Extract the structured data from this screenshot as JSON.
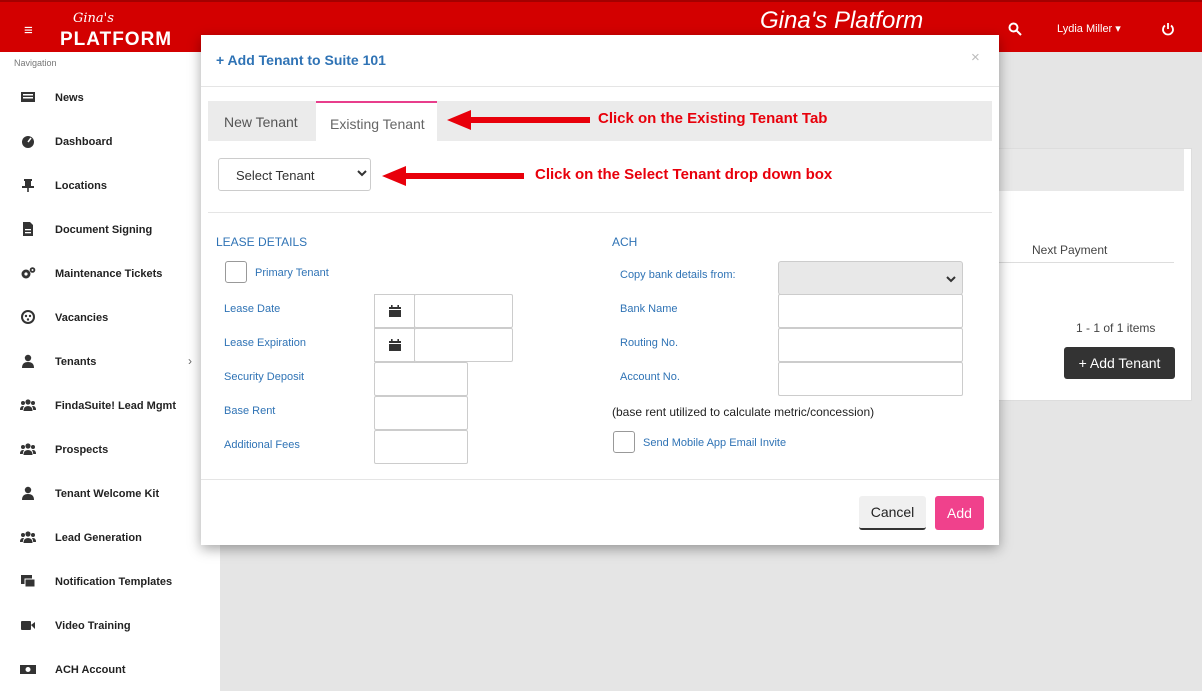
{
  "header": {
    "menu_glyph": "≡",
    "logo_script": "Gina's",
    "logo_main": "PLATFORM",
    "platform_title": "Gina's Platform",
    "user_name": "Lydia Miller ▾",
    "icons": [
      "search-icon",
      "power-icon",
      "hamburger-icon"
    ]
  },
  "sidebar": {
    "label": "Navigation",
    "items": [
      {
        "label": "News",
        "icon": "newspaper-icon"
      },
      {
        "label": "Dashboard",
        "icon": "gauge-icon"
      },
      {
        "label": "Locations",
        "icon": "pin-icon"
      },
      {
        "label": "Document Signing",
        "icon": "document-icon"
      },
      {
        "label": "Maintenance Tickets",
        "icon": "gears-icon"
      },
      {
        "label": "Vacancies",
        "icon": "vacancy-icon"
      },
      {
        "label": "Tenants",
        "icon": "user-icon",
        "chevron": "›"
      },
      {
        "label": "FindaSuite! Lead Mgmt",
        "icon": "users-icon"
      },
      {
        "label": "Prospects",
        "icon": "users-icon"
      },
      {
        "label": "Tenant Welcome Kit",
        "icon": "user-icon"
      },
      {
        "label": "Lead Generation",
        "icon": "users-icon"
      },
      {
        "label": "Notification Templates",
        "icon": "templates-icon"
      },
      {
        "label": "Video Training",
        "icon": "video-icon"
      },
      {
        "label": "ACH Account",
        "icon": "money-icon"
      }
    ]
  },
  "background_card": {
    "column_header": "Next Payment",
    "items_count": "1 - 1 of 1 items",
    "add_button": "+ Add Tenant"
  },
  "modal": {
    "title": "+ Add Tenant to Suite 101",
    "close_glyph": "×",
    "tabs": [
      {
        "label": "New Tenant",
        "active": false
      },
      {
        "label": "Existing Tenant",
        "active": true
      }
    ],
    "select_tenant": {
      "value": "Select Tenant"
    },
    "lease": {
      "heading": "LEASE DETAILS",
      "primary_tenant": "Primary Tenant",
      "lease_date": "Lease Date",
      "lease_expiration": "Lease Expiration",
      "security_deposit": "Security Deposit",
      "base_rent": "Base Rent",
      "additional_fees": "Additional Fees"
    },
    "ach": {
      "heading": "ACH",
      "copy_bank": "Copy bank details from:",
      "bank_name": "Bank Name",
      "routing_no": "Routing No.",
      "account_no": "Account No.",
      "note": "(base rent utilized to calculate metric/concession)",
      "send_invite": "Send Mobile App Email Invite"
    },
    "buttons": {
      "cancel": "Cancel",
      "add": "Add"
    }
  },
  "annotations": {
    "tab_hint": "Click on the Existing Tenant Tab",
    "select_hint": "Click on the Select Tenant drop down box"
  },
  "colors": {
    "brand_red": "#d30000",
    "link_blue": "#2f73b5",
    "add_pink": "#f0418c",
    "annotation_red": "#e8000b"
  }
}
